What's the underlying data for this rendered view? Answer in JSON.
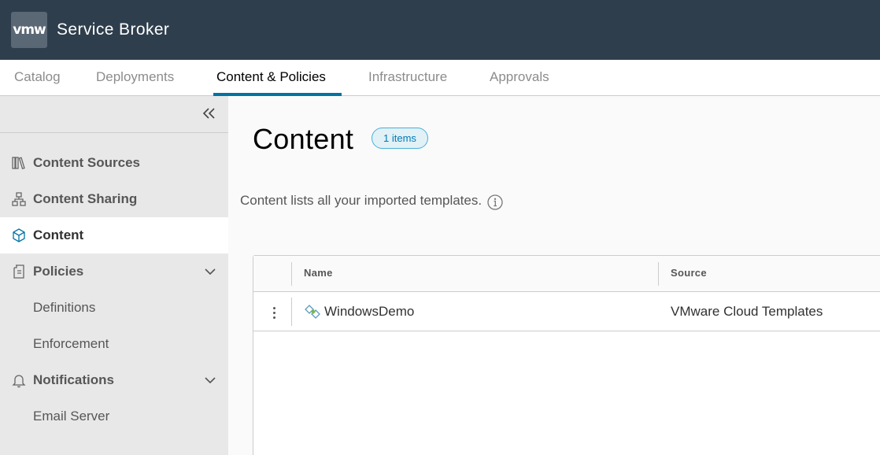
{
  "header": {
    "logo_text": "vmw",
    "app_title": "Service Broker"
  },
  "tabs": [
    {
      "label": "Catalog",
      "active": false
    },
    {
      "label": "Deployments",
      "active": false
    },
    {
      "label": "Content & Policies",
      "active": true
    },
    {
      "label": "Infrastructure",
      "active": false
    },
    {
      "label": "Approvals",
      "active": false
    }
  ],
  "sidebar": {
    "collapse_icon": "double-chevron-left-icon",
    "items": [
      {
        "label": "Content Sources",
        "icon": "library-icon",
        "active": false
      },
      {
        "label": "Content Sharing",
        "icon": "sharing-tree-icon",
        "active": false
      },
      {
        "label": "Content",
        "icon": "cube-icon",
        "active": true
      },
      {
        "label": "Policies",
        "icon": "policy-icon",
        "expanded": true
      },
      {
        "label": "Notifications",
        "icon": "bell-icon",
        "expanded": true
      }
    ],
    "sub_items": {
      "definitions": "Definitions",
      "enforcement": "Enforcement",
      "email_server": "Email Server"
    }
  },
  "main": {
    "title": "Content",
    "count_badge": "1 items",
    "description": "Content lists all your imported templates.",
    "grid": {
      "columns": [
        "Name",
        "Source"
      ],
      "rows": [
        {
          "name": "WindowsDemo",
          "source": "VMware Cloud Templates"
        }
      ]
    }
  },
  "colors": {
    "header_bg": "#2f3e4d",
    "accent": "#0072a3",
    "badge_border": "#49afd9",
    "sidebar_bg": "#e8e8e8"
  }
}
